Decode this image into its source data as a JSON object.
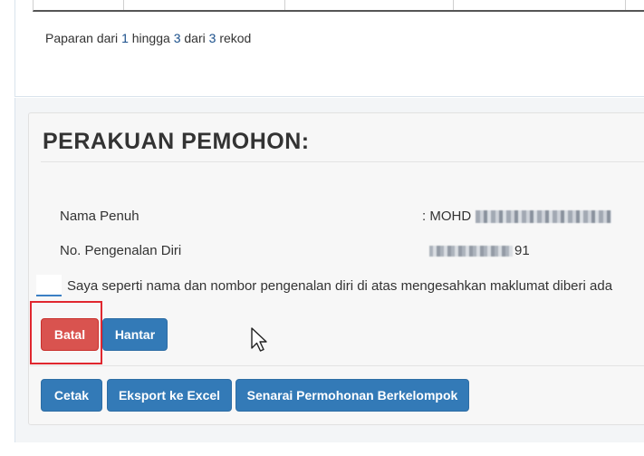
{
  "table": {
    "footer": {
      "prefix": "Paparan dari",
      "from": "1",
      "to_word": "hingga",
      "to": "3",
      "of_word": "dari",
      "total": "3",
      "suffix": "rekod"
    }
  },
  "declaration_section": {
    "title": "PERAKUAN PEMOHON:",
    "fields": [
      {
        "label": "Nama Penuh",
        "value": ": MOHD"
      },
      {
        "label": "No. Pengenalan Diri",
        "value": "91"
      }
    ],
    "checkbox_text": "Saya seperti nama dan nombor pengenalan diri di atas mengesahkan maklumat diberi ada",
    "buttons": {
      "cancel": "Batal",
      "submit": "Hantar"
    }
  },
  "actions": {
    "print": "Cetak",
    "export": "Eksport ke Excel",
    "group_list": "Senarai Permohonan Berkelompok"
  },
  "colors": {
    "danger": "#d9534f",
    "primary": "#337ab7",
    "highlight": "#e0272f"
  }
}
